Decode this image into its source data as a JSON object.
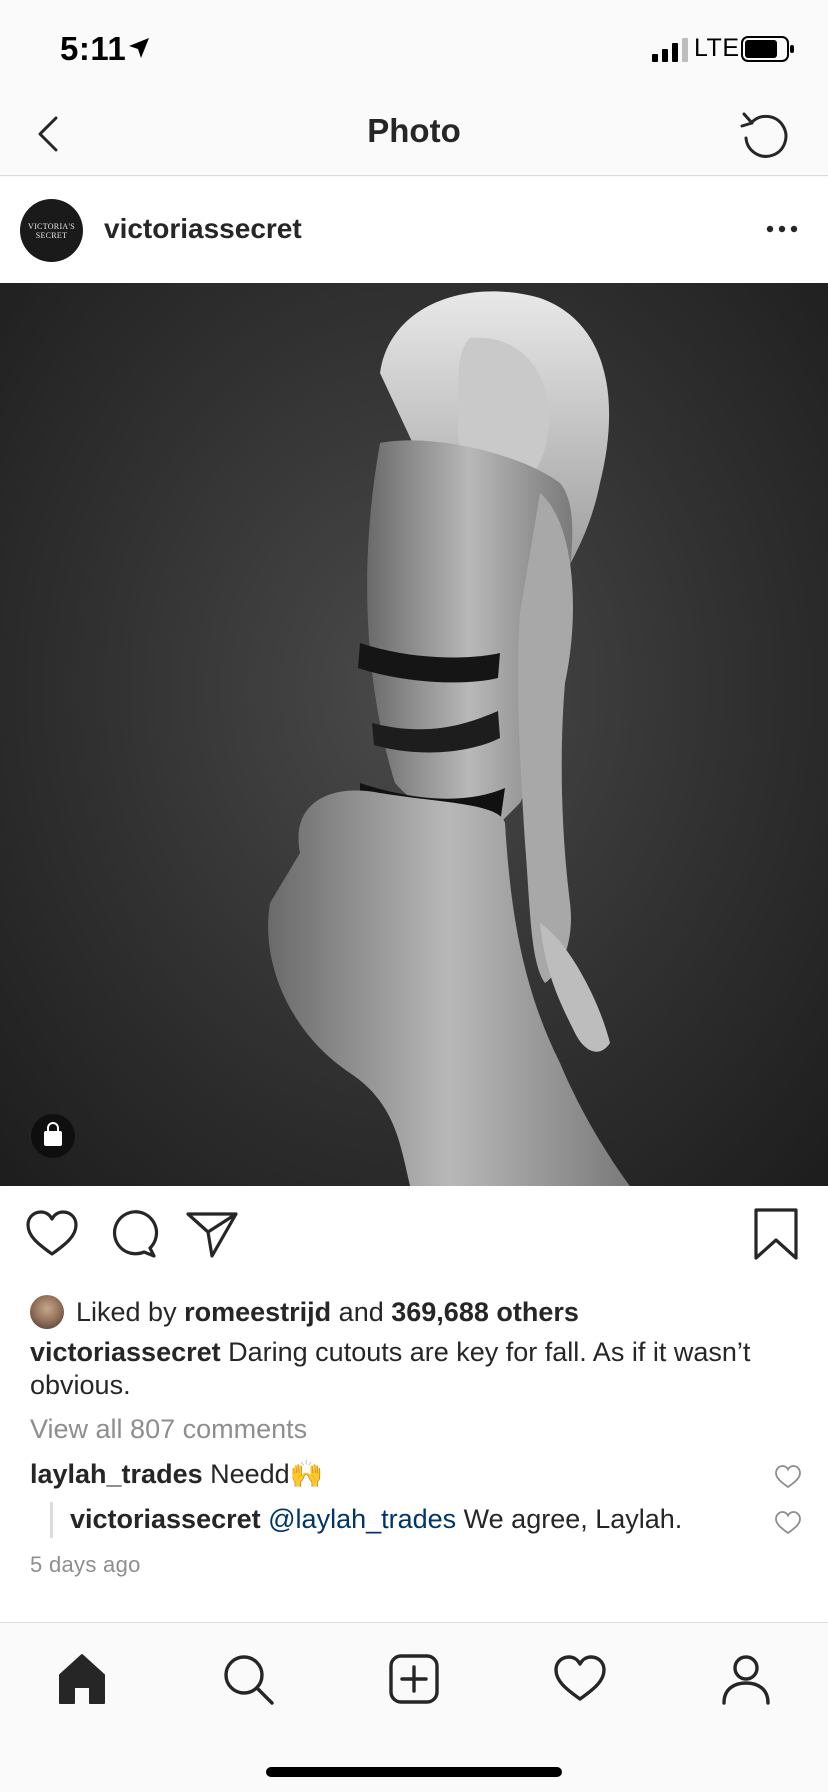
{
  "status_bar": {
    "time": "5:11",
    "network": "LTE",
    "icons": [
      "location-arrow-icon",
      "signal-bars-icon",
      "battery-icon"
    ]
  },
  "header": {
    "title": "Photo",
    "back_icon": "chevron-left-icon",
    "refresh_icon": "refresh-icon"
  },
  "post": {
    "username": "victoriassecret",
    "avatar_text_line1": "VICTORIA'S",
    "avatar_text_line2": "SECRET",
    "more_icon": "more-horizontal-icon",
    "shopping_icon": "shopping-bag-icon",
    "actions": [
      "heart-icon",
      "comment-icon",
      "share-icon",
      "bookmark-icon"
    ],
    "likes": {
      "prefix": "Liked by",
      "user": "romeestrijd",
      "connector": "and",
      "count": "369,688 others"
    },
    "caption": {
      "username": "victoriassecret",
      "text": "Daring cutouts are key for fall. As if it wasn’t obvious."
    },
    "view_all_comments": "View all 807 comments",
    "comments": [
      {
        "username": "laylah_trades",
        "text": "Needd🙌"
      },
      {
        "username": "victoriassecret",
        "mention": "@laylah_trades",
        "text": "We agree, Laylah."
      }
    ],
    "timestamp": "5 days ago"
  },
  "tab_bar": {
    "items": [
      "home-icon",
      "search-icon",
      "new-post-icon",
      "activity-heart-icon",
      "profile-icon"
    ]
  },
  "colors": {
    "background": "#fafafa",
    "text": "#262626",
    "secondary_text": "#8e8e8e",
    "mention": "#003569",
    "divider": "#dbdbdb"
  }
}
